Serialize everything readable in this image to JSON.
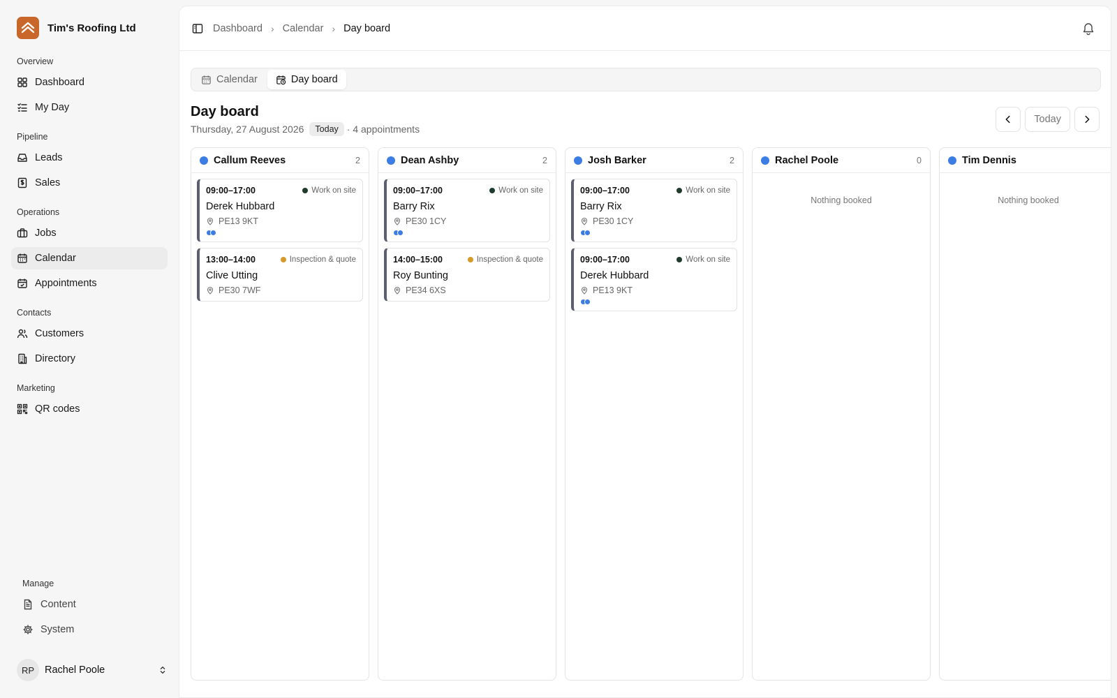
{
  "brand": {
    "name": "Tim's Roofing Ltd",
    "color": "#c9672b"
  },
  "sidebar": {
    "sections": [
      {
        "label": "Overview",
        "items": [
          {
            "label": "Dashboard",
            "icon": "grid-icon"
          },
          {
            "label": "My Day",
            "icon": "checklist-icon"
          }
        ]
      },
      {
        "label": "Pipeline",
        "items": [
          {
            "label": "Leads",
            "icon": "inbox-icon"
          },
          {
            "label": "Sales",
            "icon": "dollar-receipt-icon"
          }
        ]
      },
      {
        "label": "Operations",
        "items": [
          {
            "label": "Jobs",
            "icon": "briefcase-icon"
          },
          {
            "label": "Calendar",
            "icon": "calendar-icon",
            "active": true
          },
          {
            "label": "Appointments",
            "icon": "calendar-check-icon"
          }
        ]
      },
      {
        "label": "Contacts",
        "items": [
          {
            "label": "Customers",
            "icon": "users-icon"
          },
          {
            "label": "Directory",
            "icon": "building-icon"
          }
        ]
      },
      {
        "label": "Marketing",
        "items": [
          {
            "label": "QR codes",
            "icon": "qr-code-icon"
          }
        ]
      }
    ],
    "manage": {
      "label": "Manage",
      "items": [
        {
          "label": "Content",
          "icon": "document-icon"
        },
        {
          "label": "System",
          "icon": "gear-icon"
        }
      ]
    },
    "user": {
      "initials": "RP",
      "name": "Rachel Poole"
    }
  },
  "topbar": {
    "breadcrumbs": [
      "Dashboard",
      "Calendar",
      "Day board"
    ]
  },
  "tabs": [
    {
      "label": "Calendar",
      "icon": "calendar-icon"
    },
    {
      "label": "Day board",
      "icon": "calendar-clock-icon",
      "active": true
    }
  ],
  "page": {
    "title": "Day board",
    "date": "Thursday, 27 August 2026",
    "today_badge": "Today",
    "appointments_text": "· 4 appointments",
    "today_button": "Today"
  },
  "colors": {
    "accent_blue": "#3b7de3",
    "work_on_site": "#1f3b2c",
    "inspection_quote": "#d49a2a",
    "card_border": "#5b5f70"
  },
  "columns": [
    {
      "name": "Callum Reeves",
      "count": "2",
      "cards": [
        {
          "time": "09:00–17:00",
          "type": "Work on site",
          "type_color": "#1f3b2c",
          "name": "Derek Hubbard",
          "postcode": "PE13 9KT",
          "assignees": 2
        },
        {
          "time": "13:00–14:00",
          "type": "Inspection & quote",
          "type_color": "#d49a2a",
          "name": "Clive Utting",
          "postcode": "PE30 7WF",
          "assignees": 0
        }
      ]
    },
    {
      "name": "Dean Ashby",
      "count": "2",
      "cards": [
        {
          "time": "09:00–17:00",
          "type": "Work on site",
          "type_color": "#1f3b2c",
          "name": "Barry Rix",
          "postcode": "PE30 1CY",
          "assignees": 2
        },
        {
          "time": "14:00–15:00",
          "type": "Inspection & quote",
          "type_color": "#d49a2a",
          "name": "Roy Bunting",
          "postcode": "PE34 6XS",
          "assignees": 0
        }
      ]
    },
    {
      "name": "Josh Barker",
      "count": "2",
      "cards": [
        {
          "time": "09:00–17:00",
          "type": "Work on site",
          "type_color": "#1f3b2c",
          "name": "Barry Rix",
          "postcode": "PE30 1CY",
          "assignees": 2
        },
        {
          "time": "09:00–17:00",
          "type": "Work on site",
          "type_color": "#1f3b2c",
          "name": "Derek Hubbard",
          "postcode": "PE13 9KT",
          "assignees": 2
        }
      ]
    },
    {
      "name": "Rachel Poole",
      "count": "0",
      "empty_text": "Nothing booked",
      "cards": []
    },
    {
      "name": "Tim Dennis",
      "count": "",
      "empty_text": "Nothing booked",
      "cards": []
    }
  ]
}
